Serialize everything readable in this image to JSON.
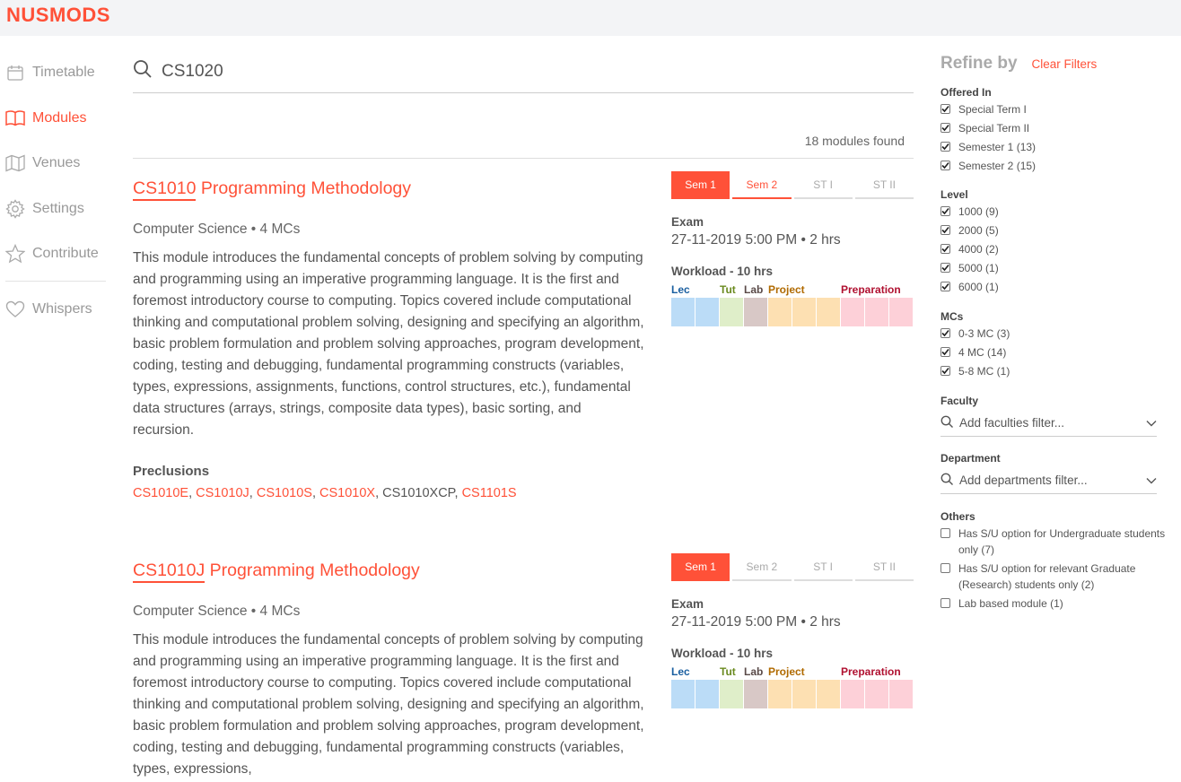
{
  "app": {
    "logo": "NUSMODS"
  },
  "colors": {
    "accent": "#ff5138"
  },
  "sidebar": {
    "items": [
      {
        "label": "Timetable",
        "icon": "calendar-icon",
        "active": false
      },
      {
        "label": "Modules",
        "icon": "book-icon",
        "active": true
      },
      {
        "label": "Venues",
        "icon": "map-icon",
        "active": false
      },
      {
        "label": "Settings",
        "icon": "gear-icon",
        "active": false
      },
      {
        "label": "Contribute",
        "icon": "star-icon",
        "active": false
      }
    ],
    "extra": {
      "label": "Whispers",
      "icon": "heart-icon"
    }
  },
  "search": {
    "value": "CS1020"
  },
  "results": {
    "count_text": "18 modules found"
  },
  "modules": [
    {
      "code": "CS1010",
      "title": "Programming Methodology",
      "meta": "Computer Science • 4 MCs",
      "description": "This module introduces the fundamental concepts of problem solving by computing and programming using an imperative programming language. It is the first and foremost introductory course to computing. Topics covered include computational thinking and computational problem solving, designing and specifying an algorithm, basic problem formulation and problem solving approaches, program development, coding, testing and debugging, fundamental programming constructs (variables, types, expressions, assignments, functions, control structures, etc.), fundamental data structures (arrays, strings, composite data types), basic sorting, and recursion.",
      "preclusions_label": "Preclusions",
      "preclusions": [
        {
          "code": "CS1010E",
          "link": true
        },
        {
          "code": "CS1010J",
          "link": true
        },
        {
          "code": "CS1010S",
          "link": true
        },
        {
          "code": "CS1010X",
          "link": true
        },
        {
          "code": "CS1010XCP",
          "link": false
        },
        {
          "code": "CS1101S",
          "link": true
        }
      ],
      "tabs": [
        "Sem 1",
        "Sem 2",
        "ST I",
        "ST II"
      ],
      "exam_label": "Exam",
      "exam": "27-11-2019 5:00 PM • 2 hrs",
      "workload_title": "Workload - 10 hrs",
      "workload": {
        "lec": "Lec",
        "tut": "Tut",
        "lab": "Lab",
        "project": "Project",
        "prep": "Preparation"
      }
    },
    {
      "code": "CS1010J",
      "title": "Programming Methodology",
      "meta": "Computer Science • 4 MCs",
      "description": "This module introduces the fundamental concepts of problem solving by computing and programming using an imperative programming language. It is the first and foremost introductory course to computing. Topics covered include computational thinking and computational problem solving, designing and specifying an algorithm, basic problem formulation and problem solving approaches, program development, coding, testing and debugging, fundamental programming constructs (variables, types, expressions,",
      "tabs": [
        "Sem 1",
        "Sem 2",
        "ST I",
        "ST II"
      ],
      "exam_label": "Exam",
      "exam": "27-11-2019 5:00 PM • 2 hrs",
      "workload_title": "Workload - 10 hrs",
      "workload": {
        "lec": "Lec",
        "tut": "Tut",
        "lab": "Lab",
        "project": "Project",
        "prep": "Preparation"
      }
    }
  ],
  "workload_colors": {
    "lec": "#bbdcf7",
    "tut": "#dfeec9",
    "lab": "#d8c8c6",
    "project": "#fde0b2",
    "prep": "#fdd0d8"
  },
  "workload_label_colors": {
    "lec": "#1a5fa0",
    "tut": "#6a8a1f",
    "lab": "#5a4a48",
    "project": "#b06a00",
    "prep": "#b01030"
  },
  "refine": {
    "title": "Refine by",
    "clear": "Clear Filters",
    "offered_in": {
      "title": "Offered In",
      "options": [
        "Special Term I",
        "Special Term II",
        "Semester 1 (13)",
        "Semester 2 (15)"
      ]
    },
    "level": {
      "title": "Level",
      "options": [
        "1000 (9)",
        "2000 (5)",
        "4000 (2)",
        "5000 (1)",
        "6000 (1)"
      ]
    },
    "mcs": {
      "title": "MCs",
      "options": [
        "0-3 MC (3)",
        "4 MC (14)",
        "5-8 MC (1)"
      ]
    },
    "faculty": {
      "title": "Faculty",
      "placeholder": "Add faculties filter..."
    },
    "department": {
      "title": "Department",
      "placeholder": "Add departments filter..."
    },
    "others": {
      "title": "Others",
      "options": [
        "Has S/U option for Undergraduate students only (7)",
        "Has S/U option for relevant Graduate (Research) students only (2)",
        "Lab based module (1)"
      ]
    }
  }
}
